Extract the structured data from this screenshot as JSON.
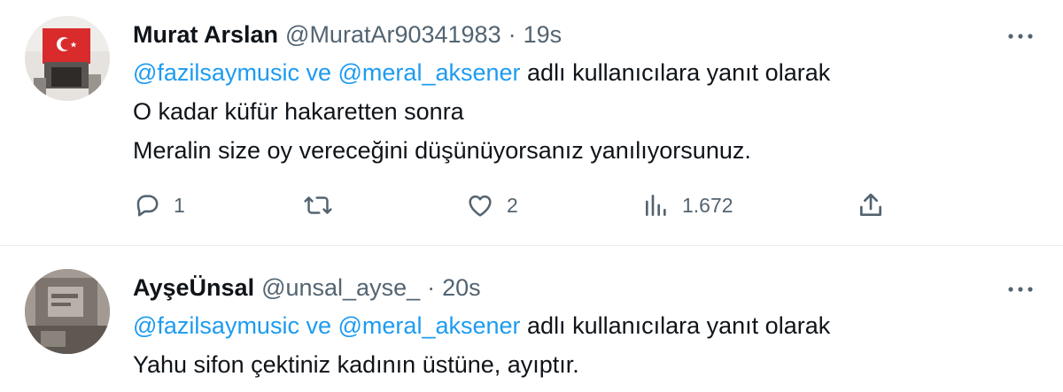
{
  "tweets": [
    {
      "name": "Murat Arslan",
      "handle": "@MuratAr90341983",
      "separator": "·",
      "time": "19s",
      "replying": {
        "mention1": "@fazilsaymusic",
        "connector": "ve",
        "mention2": "@meral_aksener",
        "suffix": "adlı kullanıcılara yanıt olarak"
      },
      "text_lines": [
        "O kadar küfür hakaretten sonra",
        "Meralin size oy vereceğini düşünüyorsanız yanılıyorsunuz."
      ],
      "stats": {
        "replies": "1",
        "retweets": "",
        "likes": "2",
        "views": "1.672"
      }
    },
    {
      "name": "AyşeÜnsal",
      "handle": "@unsal_ayse_",
      "separator": "·",
      "time": "20s",
      "replying": {
        "mention1": "@fazilsaymusic",
        "connector": "ve",
        "mention2": "@meral_aksener",
        "suffix": "adlı kullanıcılara yanıt olarak"
      },
      "text_lines": [
        "Yahu sifon çektiniz kadının üstüne, ayıptır."
      ]
    }
  ],
  "icons": {
    "more": "more-horizontal-icon",
    "reply": "reply-bubble-icon",
    "retweet": "retweet-icon",
    "like": "heart-icon",
    "views": "views-chart-icon",
    "share": "share-upload-icon"
  },
  "colors": {
    "text": "#0f1419",
    "secondary": "#536471",
    "mention": "#1d9bf0",
    "divider": "#e9ecef"
  }
}
